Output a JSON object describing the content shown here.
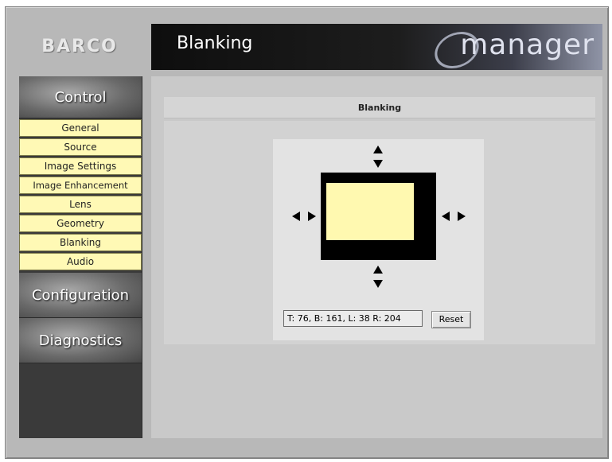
{
  "logo": {
    "text": "BARCO"
  },
  "header": {
    "title": "Blanking",
    "brand": "manager"
  },
  "sidebar": {
    "sections": [
      {
        "label": "Control"
      },
      {
        "label": "Configuration"
      },
      {
        "label": "Diagnostics"
      }
    ],
    "control_items": [
      {
        "label": "General"
      },
      {
        "label": "Source"
      },
      {
        "label": "Image Settings"
      },
      {
        "label": "Image Enhancement"
      },
      {
        "label": "Lens"
      },
      {
        "label": "Geometry"
      },
      {
        "label": "Blanking"
      },
      {
        "label": "Audio"
      }
    ]
  },
  "panel": {
    "title": "Blanking",
    "status_value": "T: 76, B: 161, L: 38 R: 204",
    "reset_label": "Reset"
  },
  "colors": {
    "menu_bg": "#fff9b5",
    "screen_fill": "#fff9b0",
    "header_bg": "#1d1d1d"
  }
}
